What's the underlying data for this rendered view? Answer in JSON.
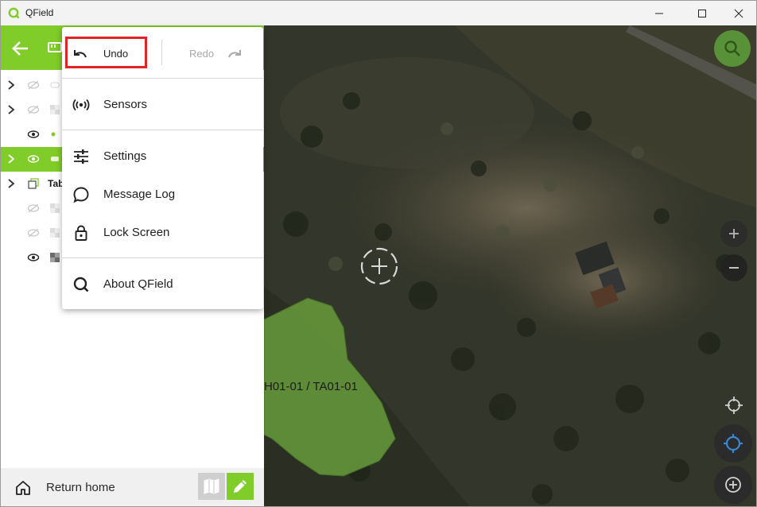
{
  "window": {
    "title": "QField"
  },
  "menu": {
    "undo_label": "Undo",
    "redo_label": "Redo",
    "items": [
      {
        "label": "Sensors",
        "icon": "sensors-icon"
      },
      {
        "label": "Settings",
        "icon": "settings-icon"
      },
      {
        "label": "Message Log",
        "icon": "message-log-icon"
      },
      {
        "label": "Lock Screen",
        "icon": "lock-icon"
      },
      {
        "label": "About QField",
        "icon": "qfield-logo-icon"
      }
    ]
  },
  "layers": {
    "group_label": "Tab"
  },
  "footer": {
    "home_label": "Return home"
  },
  "map": {
    "feature_label": "H01-01 / TA01-01"
  },
  "colors": {
    "accent": "#80cc28",
    "highlight": "#e02424",
    "polygon": "#6aa03c"
  }
}
